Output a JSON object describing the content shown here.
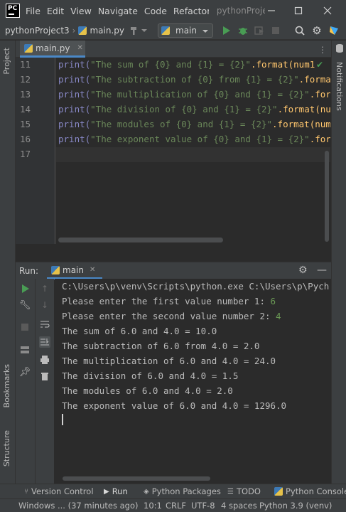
{
  "app": {
    "logo_text": "PC",
    "menu": [
      {
        "label": "File",
        "mnemonic": "F"
      },
      {
        "label": "Edit",
        "mnemonic": "E"
      },
      {
        "label": "View",
        "mnemonic": "V"
      },
      {
        "label": "Navigate",
        "mnemonic": "N"
      },
      {
        "label": "Code",
        "mnemonic": "C"
      },
      {
        "label": "Refactor",
        "mnemonic": "R"
      }
    ],
    "menu_labels": {
      "file": "File",
      "edit": "Edit",
      "view": "View",
      "navigate": "Navigate",
      "code": "Code",
      "refactor": "Refactor"
    },
    "window_title": "pythonProject3"
  },
  "navbar": {
    "project": "pythonProject3",
    "file": "main.py",
    "run_config": "main"
  },
  "left_stripe": {
    "project": "Project",
    "bookmarks": "Bookmarks",
    "structure": "Structure"
  },
  "right_stripe": {
    "notifications": "Notifications"
  },
  "editor": {
    "tab": "main.py",
    "line_numbers": [
      "11",
      "12",
      "13",
      "14",
      "15",
      "16",
      "17"
    ],
    "lines": [
      {
        "pre": "print(",
        "str": "\"The sum of {0} and {1} = {2}\"",
        "post": ".format(num1 "
      },
      {
        "pre": "print(",
        "str": "\"The subtraction of {0} from {1} = {2}\"",
        "post": ".format"
      },
      {
        "pre": "print(",
        "str": "\"The multiplication of {0} and {1} = {2}\"",
        "post": ".form"
      },
      {
        "pre": "print(",
        "str": "\"The division of {0} and {1} = {2}\"",
        "post": ".format(nu"
      },
      {
        "pre": "print(",
        "str": "\"The modules of {0} and {1} = {2}\"",
        "post": ".format(num"
      },
      {
        "pre": "print(",
        "str": "\"The exponent value of {0} and {1} = {2}\"",
        "post": ".for"
      },
      {
        "pre": "",
        "str": "",
        "post": ""
      }
    ]
  },
  "run": {
    "label": "Run:",
    "tab": "main",
    "console": [
      {
        "text": "C:\\Users\\p\\venv\\Scripts\\python.exe C:\\Users\\p\\Pych",
        "input": ""
      },
      {
        "text": "Please enter the first value number 1: ",
        "input": "6"
      },
      {
        "text": "Please enter the second value number 2: ",
        "input": "4"
      },
      {
        "text": "The sum of 6.0 and 4.0 = 10.0",
        "input": ""
      },
      {
        "text": "The subtraction of 6.0 from 4.0 = 2.0",
        "input": ""
      },
      {
        "text": "The multiplication of 6.0 and 4.0 = 24.0",
        "input": ""
      },
      {
        "text": "The division of 6.0 and 4.0 = 1.5",
        "input": ""
      },
      {
        "text": "The modules of 6.0 and 4.0 = 2.0",
        "input": ""
      },
      {
        "text": "The exponent value of 6.0 and 4.0 = 1296.0",
        "input": ""
      }
    ]
  },
  "bottom_bar": {
    "version_control": "Version Control",
    "run": "Run",
    "python_packages": "Python Packages",
    "todo": "TODO",
    "python_console": "Python Console"
  },
  "status_bar": {
    "message": "Windows ... (37 minutes ago)",
    "position": "10:1",
    "line_separator": "CRLF",
    "encoding": "UTF-8",
    "indent": "4 spaces",
    "interpreter": "Python 3.9 (venv)"
  },
  "colors": {
    "accent": "#4a88c7",
    "run_green": "#499c54",
    "string": "#6a8759",
    "keyword": "#8888c6"
  }
}
